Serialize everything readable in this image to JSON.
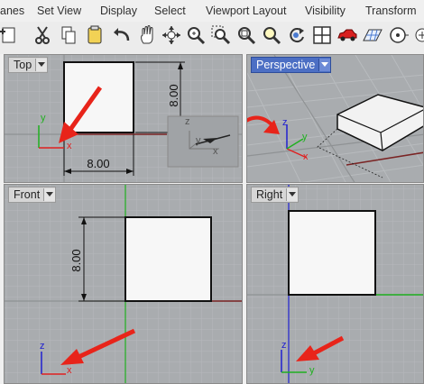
{
  "menubar": {
    "items": [
      "anes",
      "Set View",
      "Display",
      "Select",
      "Viewport Layout",
      "Visibility",
      "Transform"
    ]
  },
  "toolbar": {
    "icons": [
      "new-file-icon",
      "cut-icon",
      "copy-icon",
      "paste-icon",
      "undo-icon",
      "pan-hand-icon",
      "rotate-view-icon",
      "zoom-dynamic-icon",
      "zoom-window-icon",
      "zoom-extents-icon",
      "zoom-selected-icon",
      "undo-view-icon",
      "four-viewports-icon",
      "car-render-icon",
      "grid-plane-icon",
      "target-icon",
      "more-icon"
    ]
  },
  "viewports": {
    "top": {
      "title": "Top",
      "dimension_h": "8.00",
      "dimension_v": "8.00",
      "axis_x": "x",
      "axis_y": "y"
    },
    "perspective": {
      "title": "Perspective",
      "axis_x": "x",
      "axis_y": "y",
      "axis_z": "z"
    },
    "front": {
      "title": "Front",
      "dimension_v": "8.00",
      "axis_x": "x",
      "axis_z": "z"
    },
    "right": {
      "title": "Right",
      "axis_y": "y",
      "axis_z": "z"
    }
  },
  "inset": {
    "axis_x": "x",
    "axis_y": "y",
    "axis_z": "z"
  },
  "colors": {
    "viewport_bg": "#a9acaf",
    "grid_minor": "#b6b9bc",
    "grid_major": "#8f9294",
    "axis_red": "#e02020",
    "axis_green": "#20b020",
    "axis_blue": "#2020d0",
    "arrow_red": "#e8241a",
    "active_title": "#4c6fc4",
    "object_fill": "#f7f7f7"
  }
}
